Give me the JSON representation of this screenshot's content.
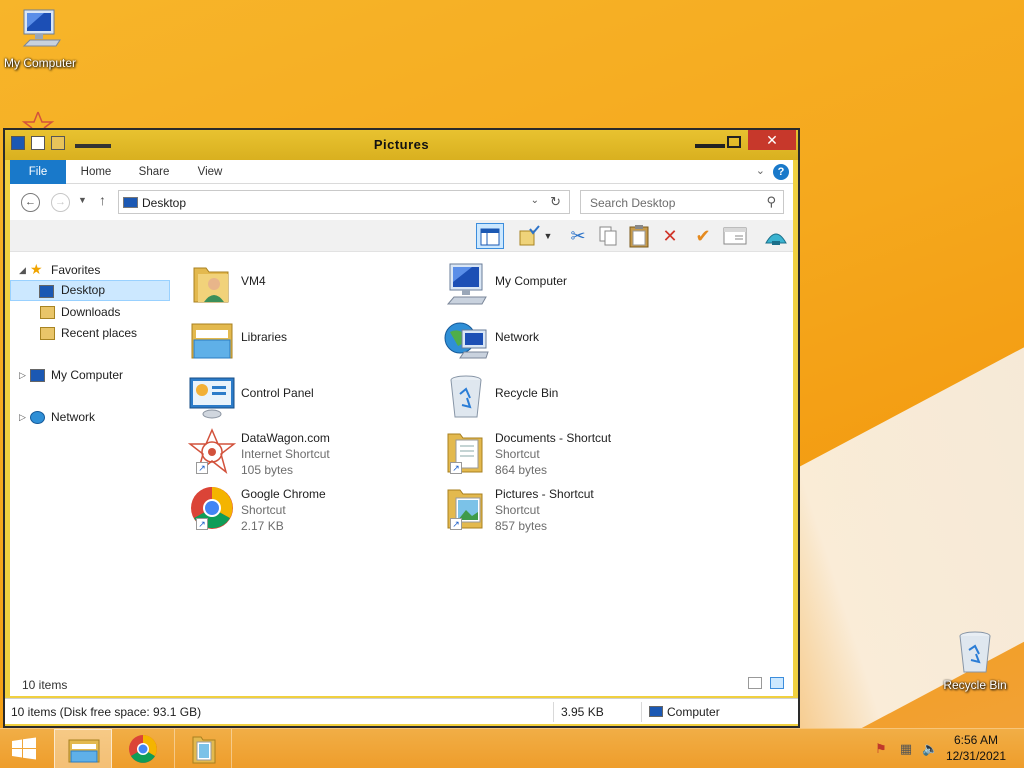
{
  "desktop": {
    "icons": [
      {
        "label": "My Computer"
      },
      {
        "label": "Recycle Bin"
      }
    ]
  },
  "window": {
    "title": "Pictures",
    "close_glyph": "✕",
    "ribbon": {
      "tabs": [
        "File",
        "Home",
        "Share",
        "View"
      ],
      "help_glyph": "?"
    },
    "address": {
      "path": "Desktop",
      "search_placeholder": "Search Desktop"
    },
    "toolbar_icons": [
      "preview-pane-icon",
      "select-all-icon",
      "dropdown-icon",
      "cut-icon",
      "copy-icon",
      "paste-icon",
      "delete-icon",
      "check-icon",
      "properties-icon",
      "shell-icon"
    ],
    "nav": {
      "favorites": "Favorites",
      "desktop": "Desktop",
      "downloads": "Downloads",
      "recent": "Recent places",
      "my_computer": "My Computer",
      "network": "Network"
    },
    "files": [
      {
        "name": "VM4",
        "icon": "user-folder-icon"
      },
      {
        "name": "My Computer",
        "icon": "computer-icon"
      },
      {
        "name": "Libraries",
        "icon": "libraries-icon"
      },
      {
        "name": "Network",
        "icon": "network-icon"
      },
      {
        "name": "Control Panel",
        "icon": "control-panel-icon"
      },
      {
        "name": "Recycle Bin",
        "icon": "recycle-bin-icon"
      },
      {
        "name": "DataWagon.com",
        "type": "Internet Shortcut",
        "size": "105 bytes",
        "icon": "internet-shortcut-icon"
      },
      {
        "name": "Documents - Shortcut",
        "type": "Shortcut",
        "size": "864 bytes",
        "icon": "documents-folder-icon"
      },
      {
        "name": "Google Chrome",
        "type": "Shortcut",
        "size": "2.17 KB",
        "icon": "chrome-icon"
      },
      {
        "name": "Pictures - Shortcut",
        "type": "Shortcut",
        "size": "857 bytes",
        "icon": "pictures-folder-icon"
      }
    ],
    "item_count": "10 items",
    "status": {
      "summary": "10 items (Disk free space: 93.1 GB)",
      "size": "3.95 KB",
      "location": "Computer"
    }
  },
  "taskbar": {
    "apps": [
      "file-explorer-icon",
      "chrome-icon",
      "folder-icon"
    ],
    "clock": {
      "time": "6:56 AM",
      "date": "12/31/2021"
    }
  },
  "colors": {
    "accent": "#1979CA",
    "wallpaper": "#F5A81D",
    "close": "#C7382B",
    "selection": "#CCE8FF"
  }
}
